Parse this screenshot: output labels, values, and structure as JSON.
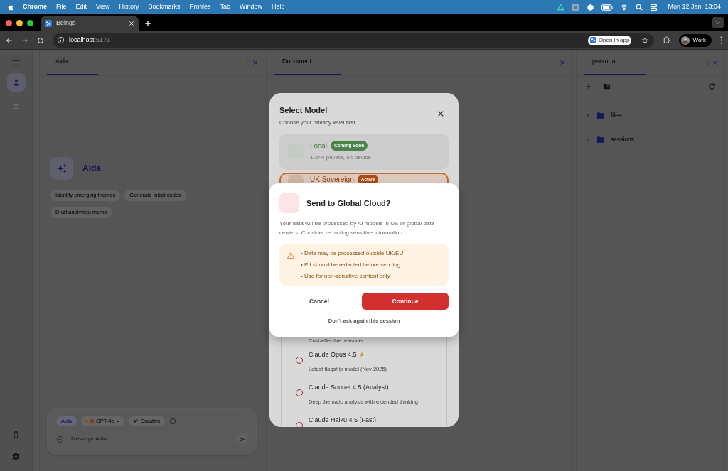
{
  "menu_bar": {
    "app": "Chrome",
    "menus": [
      "File",
      "Edit",
      "View",
      "History",
      "Bookmarks",
      "Profiles",
      "Tab",
      "Window",
      "Help"
    ],
    "clock": "Mon 12 Jan  13:04"
  },
  "browser": {
    "tabs": [
      {
        "title": "Beings",
        "selected": true
      }
    ],
    "host": "localhost",
    "port": ":5173",
    "open_in_app": "Open in app",
    "profile": "Work"
  },
  "rail": [
    {
      "kind": "person",
      "selected": true
    },
    {
      "kind": "group",
      "selected": false
    }
  ],
  "panels": [
    {
      "title": "Aida"
    },
    {
      "title": "Document"
    },
    {
      "title": "personal"
    }
  ],
  "assistant": {
    "name": "Aida",
    "suggestions": [
      "Identify emerging themes",
      "Generate initial codes",
      "Draft analytical memo"
    ],
    "composer": {
      "agent": "Aida",
      "model": "GPT-4o",
      "mode": "Creative",
      "placeholder": "Message Aida..."
    }
  },
  "file_tree": [
    {
      "name": "files",
      "expanded": false
    },
    {
      "name": "sessions",
      "expanded": false
    }
  ],
  "select_model": {
    "title": "Select Model",
    "subtitle": "Choose your privacy level first",
    "tiers": [
      {
        "kind": "local",
        "name": "Local",
        "badge": "Coming Soon",
        "description": "100% private, on-device",
        "selected": false
      },
      {
        "kind": "sovereign",
        "name": "UK Sovereign",
        "badge": "Active",
        "selected": true
      }
    ],
    "models": [
      {
        "description": "Cost-effective reasoner"
      },
      {
        "name": "Claude Opus 4.5",
        "mark": "★",
        "description": "Latest flagship model (Nov 2025)",
        "selected": false
      },
      {
        "name": "Claude Sonnet 4.5 (Analyst)",
        "description": "Deep thematic analysis with extended thinking",
        "selected": false
      },
      {
        "name": "Claude Haiku 4.5 (Fast)",
        "selected": false
      }
    ]
  },
  "confirm": {
    "title": "Send to Global Cloud?",
    "body": "Your data will be processed by AI models in US or global data centers. Consider redacting sensitive information.",
    "warnings": [
      "• Data may be processed outside UK/EU",
      "• PII should be redacted before sending",
      "• Use for non-sensitive content only"
    ],
    "cancel": "Cancel",
    "continue": "Continue",
    "dont_ask": "Don't ask again this session"
  }
}
